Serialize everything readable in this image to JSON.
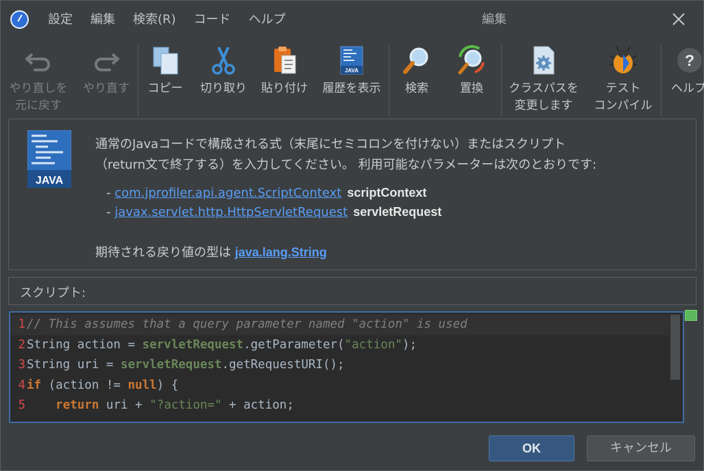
{
  "menu": [
    "設定",
    "編集",
    "検索(R)",
    "コード",
    "ヘルプ"
  ],
  "window_title": "編集",
  "toolbar": [
    {
      "label": "やり直しを\n元に戻す",
      "icon": "undo-icon",
      "disabled": true
    },
    {
      "label": "やり直す",
      "icon": "redo-icon",
      "disabled": true
    },
    {
      "label": "コピー",
      "icon": "copy-icon",
      "disabled": false
    },
    {
      "label": "切り取り",
      "icon": "cut-icon",
      "disabled": false
    },
    {
      "label": "貼り付け",
      "icon": "paste-icon",
      "disabled": false
    },
    {
      "label": "履歴を表示",
      "icon": "history-icon",
      "disabled": false
    },
    {
      "label": "検索",
      "icon": "search-icon",
      "disabled": false
    },
    {
      "label": "置換",
      "icon": "replace-icon",
      "disabled": false
    },
    {
      "label": "クラスパスを\n変更します",
      "icon": "classpath-gear-icon",
      "disabled": false
    },
    {
      "label": "テスト\nコンパイル",
      "icon": "bug-icon",
      "disabled": false
    },
    {
      "label": "ヘルプ",
      "icon": "help-icon",
      "disabled": false
    }
  ],
  "info": {
    "logo_text": "JAVA",
    "description_line1": "通常のJavaコードで構成される式（末尾にセミコロンを付けない）またはスクリプト",
    "description_line2": "（return文で終了する）を入力してください。 利用可能なパラメーターは次のとおりです:",
    "params": [
      {
        "type": "com.jprofiler.api.agent.ScriptContext",
        "name": "scriptContext"
      },
      {
        "type": "javax.servlet.http.HttpServletRequest",
        "name": "servletRequest"
      }
    ],
    "return_prefix": "期待される戻り値の型は ",
    "return_type": "java.lang.String"
  },
  "script_label": "スクリプト:",
  "code": [
    {
      "n": "1",
      "tokens": [
        [
          "cm",
          "// This assumes that a query parameter named \"action\" is used"
        ]
      ]
    },
    {
      "n": "2",
      "tokens": [
        [
          "tx",
          "String action = "
        ],
        [
          "pm",
          "servletRequest"
        ],
        [
          "tx",
          ".getParameter("
        ],
        [
          "st",
          "\"action\""
        ],
        [
          "tx",
          ");"
        ]
      ]
    },
    {
      "n": "3",
      "tokens": [
        [
          "tx",
          "String uri = "
        ],
        [
          "pm",
          "servletRequest"
        ],
        [
          "tx",
          ".getRequestURI();"
        ]
      ]
    },
    {
      "n": "4",
      "tokens": [
        [
          "kw",
          "if"
        ],
        [
          "tx",
          " (action != "
        ],
        [
          "kw",
          "null"
        ],
        [
          "tx",
          ") {"
        ]
      ]
    },
    {
      "n": "5",
      "tokens": [
        [
          "tx",
          "    "
        ],
        [
          "kw",
          "return"
        ],
        [
          "tx",
          " uri + "
        ],
        [
          "st",
          "\"?action=\""
        ],
        [
          "tx",
          " + action;"
        ]
      ]
    }
  ],
  "buttons": {
    "ok": "OK",
    "cancel": "キャンセル"
  },
  "colors": {
    "background": "#3c3f41",
    "editor_bg": "#2b2b2b",
    "link": "#589df6",
    "keyword": "#cc7832",
    "string": "#6a8759",
    "comment": "#808080",
    "line_number": "#d34a4a",
    "editor_border": "#3d6ea3",
    "ok_button": "#365880"
  }
}
